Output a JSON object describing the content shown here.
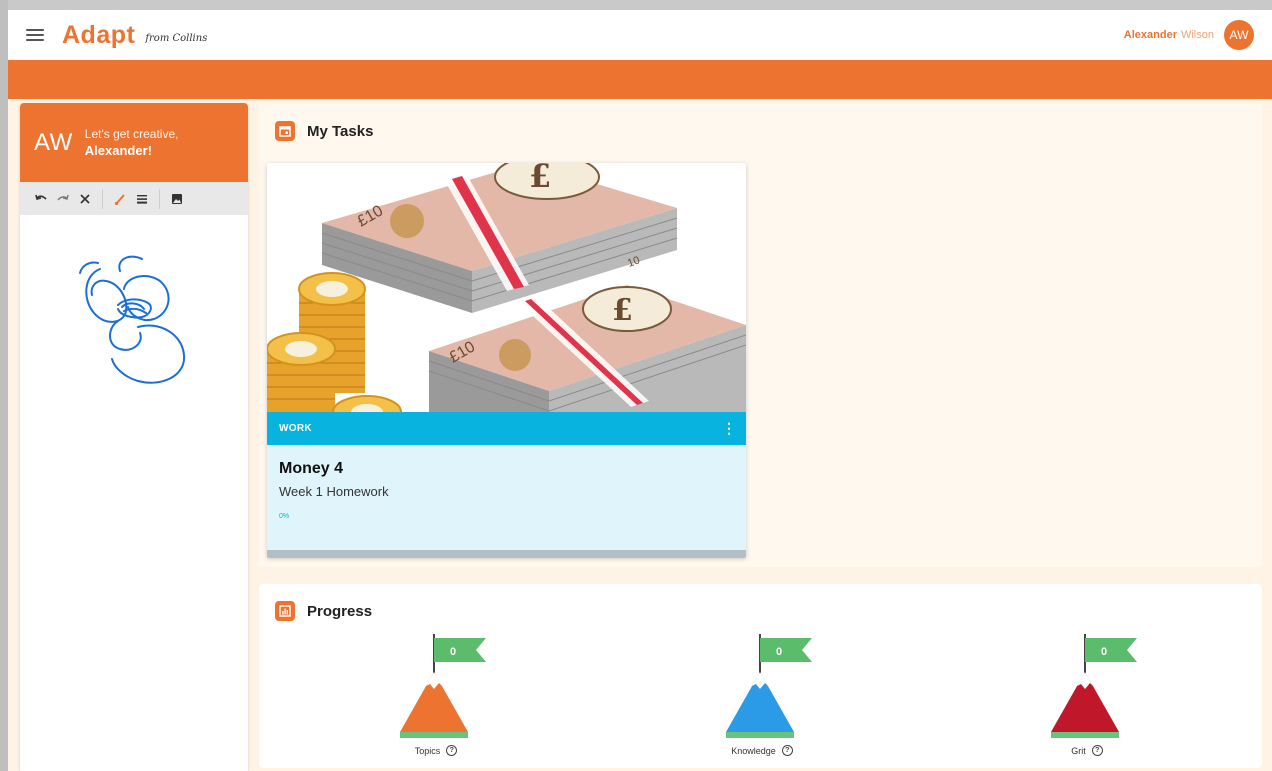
{
  "app": {
    "logo": "Adapt",
    "logo_sub": "from Collins",
    "accent_color": "#ed7430"
  },
  "user": {
    "first_name": "Alexander",
    "last_name": "Wilson",
    "initials": "AW"
  },
  "draw_panel": {
    "initials": "AW",
    "greeting_line1": "Let's get creative,",
    "greeting_line2": "Alexander!",
    "tools": [
      "undo-icon",
      "redo-icon",
      "clear-icon",
      "brush-icon",
      "line-weight-icon",
      "image-icon"
    ]
  },
  "tasks": {
    "title": "My Tasks",
    "icon": "calendar-icon",
    "cards": [
      {
        "category": "WORK",
        "title": "Money 4",
        "subtitle": "Week 1 Homework",
        "progress_text": "0%",
        "progress": 0,
        "strip_color": "#09b3df"
      }
    ]
  },
  "progress": {
    "title": "Progress",
    "icon": "bar-chart-icon",
    "metrics": [
      {
        "label": "Topics",
        "value": "0",
        "color": "#ed7430"
      },
      {
        "label": "Knowledge",
        "value": "0",
        "color": "#2b9be8"
      },
      {
        "label": "Grit",
        "value": "0",
        "color": "#c0182a"
      }
    ]
  }
}
